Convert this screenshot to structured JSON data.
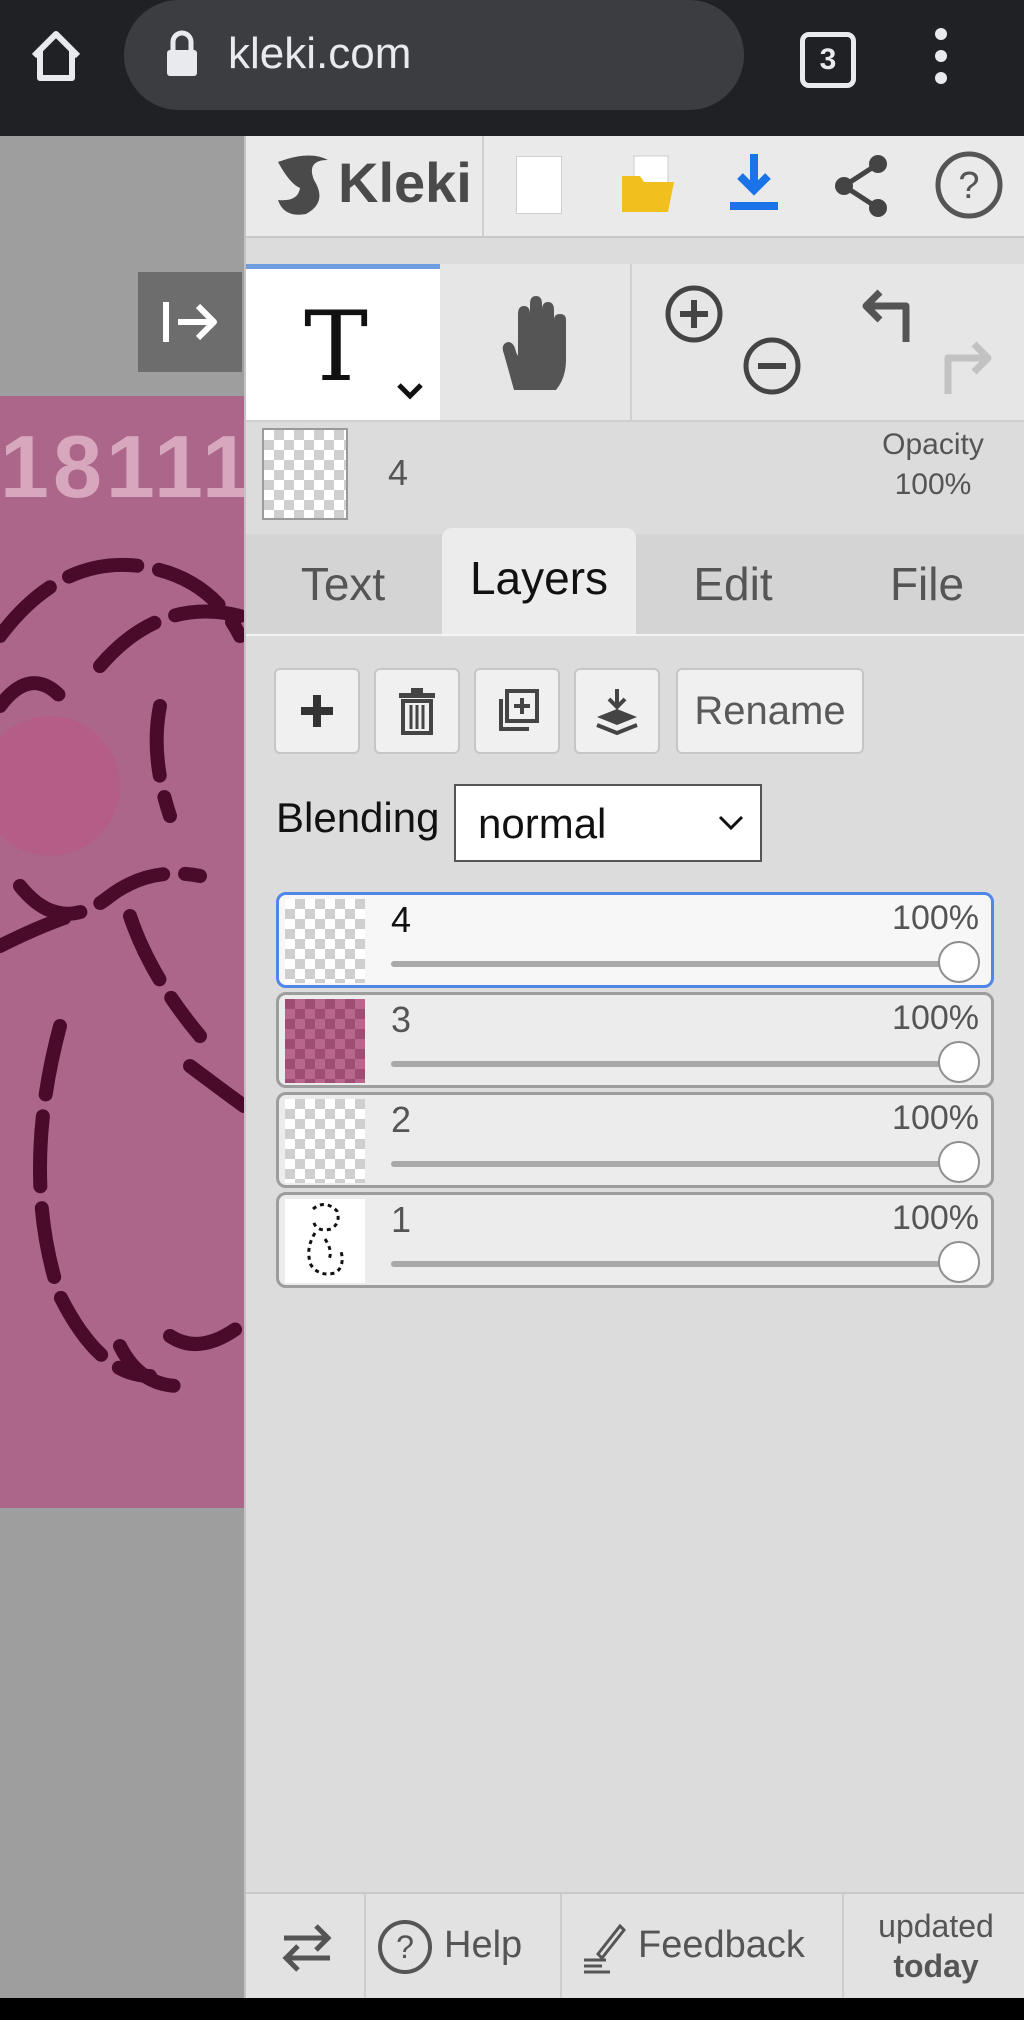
{
  "browser": {
    "url": "kleki.com",
    "tab_count": "3",
    "icons": [
      "home-icon",
      "lock-icon",
      "tabs-icon",
      "more-vert-icon"
    ]
  },
  "canvas": {
    "visible_text": "18111",
    "background_color": "#ab6689",
    "line_color": "#4a0a2a"
  },
  "app": {
    "logo_text": "Kleki",
    "header_icons": [
      "new-image-icon",
      "open-folder-icon",
      "save-download-icon",
      "share-icon",
      "help-icon"
    ]
  },
  "tools": {
    "active_tool": "text",
    "tool_glyph": "T",
    "other_tools": [
      "hand-icon",
      "zoom-in-icon",
      "zoom-out-icon",
      "undo-icon",
      "redo-icon"
    ]
  },
  "current_layer": {
    "name": "4",
    "opacity_label": "Opacity",
    "opacity_value": "100%"
  },
  "tabs": [
    {
      "label": "Text",
      "active": false
    },
    {
      "label": "Layers",
      "active": true
    },
    {
      "label": "Edit",
      "active": false
    },
    {
      "label": "File",
      "active": false
    }
  ],
  "layer_actions": {
    "buttons": [
      "add-layer-icon",
      "delete-layer-icon",
      "duplicate-layer-icon",
      "merge-down-icon"
    ],
    "rename_label": "Rename"
  },
  "blending": {
    "label": "Blending",
    "value": "normal"
  },
  "layers": [
    {
      "name": "4",
      "opacity": "100%",
      "opacity_fraction": 1.0,
      "selected": true
    },
    {
      "name": "3",
      "opacity": "100%",
      "opacity_fraction": 1.0,
      "selected": false
    },
    {
      "name": "2",
      "opacity": "100%",
      "opacity_fraction": 1.0,
      "selected": false
    },
    {
      "name": "1",
      "opacity": "100%",
      "opacity_fraction": 1.0,
      "selected": false
    }
  ],
  "footer": {
    "help_label": "Help",
    "feedback_label": "Feedback",
    "updated_label": "updated",
    "updated_value": "today"
  },
  "colors": {
    "accent": "#4f86e8",
    "save_blue": "#1a73e8",
    "folder_yellow": "#f2c01e"
  }
}
